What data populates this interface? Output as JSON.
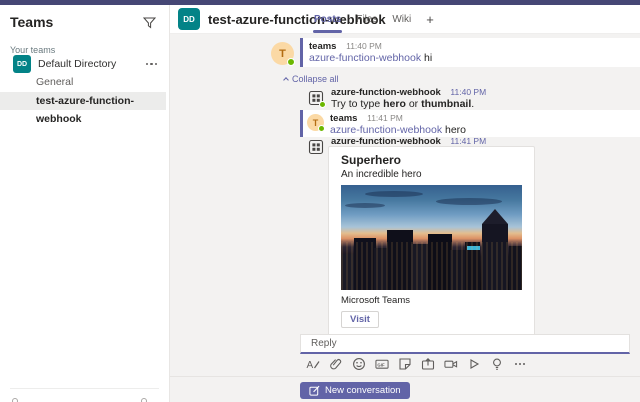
{
  "colors": {
    "accent": "#6264a7",
    "topbar": "#464775",
    "team_avatar": "#038387",
    "presence": "#6bb700",
    "page_bg": "#f3f2f1"
  },
  "sidebar": {
    "title": "Teams",
    "section_label": "Your teams",
    "team_initials": "DD",
    "team_name": "Default Directory",
    "channel_general": "General",
    "channel_selected": "test-azure-function-webhook"
  },
  "header": {
    "team_initials": "DD",
    "title": "test-azure-function-webhook",
    "tab_posts": "Posts",
    "tab_files": "Files",
    "tab_wiki": "Wiki",
    "add_tab": "+"
  },
  "thread": {
    "collapse_label": "Collapse all",
    "msg1": {
      "avatar_initial": "T",
      "author": "teams",
      "time": "11:40 PM",
      "mention": "azure-function-webhook",
      "text": "hi"
    },
    "msg2": {
      "author": "azure-function-webhook",
      "time": "11:40 PM",
      "t1": "Try to type ",
      "b1": "hero",
      "t2": " or ",
      "b2": "thumbnail",
      "t3": "."
    },
    "msg3": {
      "avatar_initial": "T",
      "author": "teams",
      "time": "11:41 PM",
      "mention": "azure-function-webhook",
      "text": "hero"
    },
    "msg4": {
      "author": "azure-function-webhook",
      "time": "11:41 PM",
      "card": {
        "title": "Superhero",
        "subtitle": "An incredible hero",
        "image_name": "city-skyline-at-dusk",
        "provider": "Microsoft Teams",
        "button_label": "Visit"
      }
    }
  },
  "compose": {
    "reply_placeholder": "Reply",
    "new_conversation_label": "New conversation",
    "icons": [
      "format",
      "attach",
      "emoji",
      "gif",
      "sticker",
      "share",
      "video",
      "stream",
      "lightbulb",
      "more"
    ]
  }
}
